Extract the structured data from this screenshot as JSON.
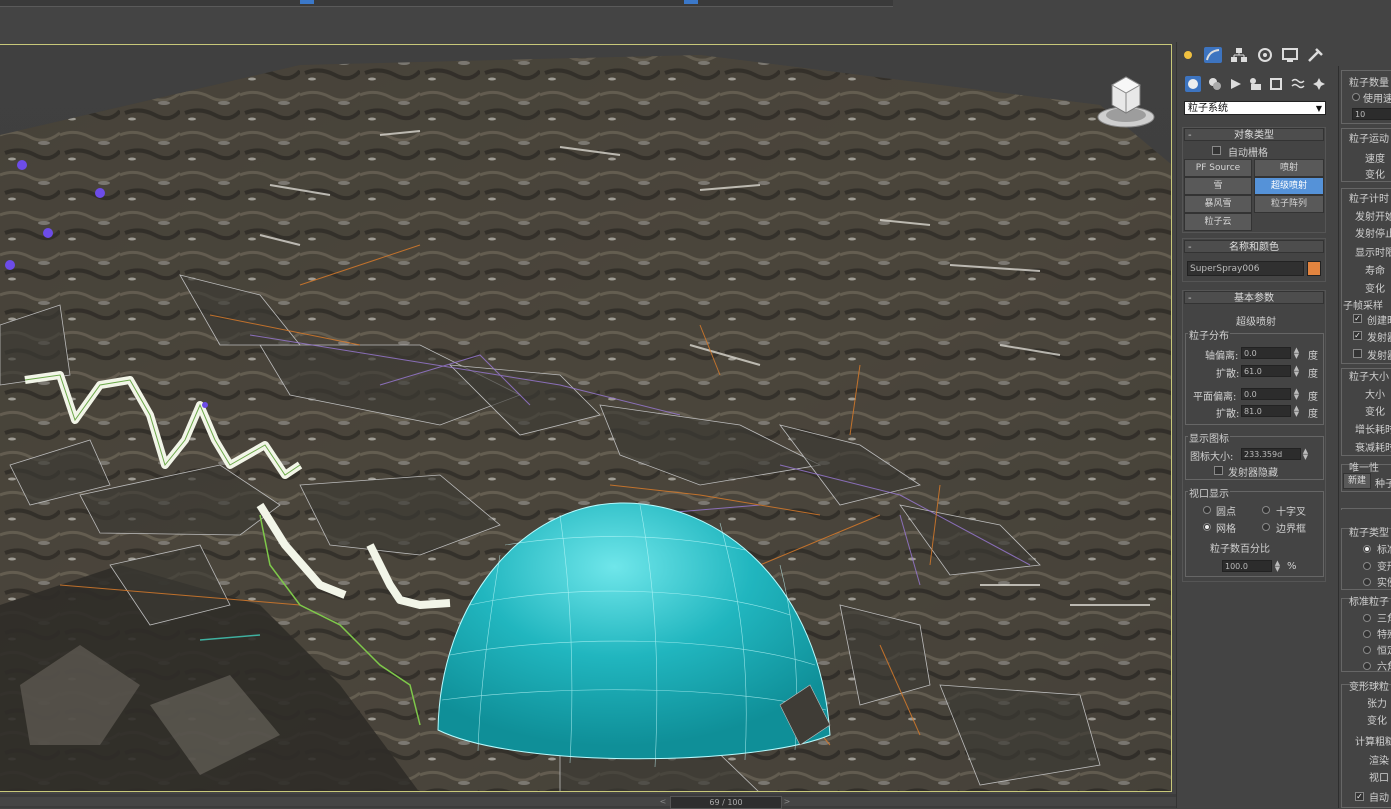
{
  "viewport": {
    "name": "perspective-viewport"
  },
  "timeline": {
    "frame_label": "69 / 100",
    "prev": "<",
    "next": ">"
  },
  "command_panel": {
    "tabs": [
      "create-tab",
      "modify-tab",
      "hierarchy-tab",
      "motion-tab",
      "display-tab",
      "utilities-tab"
    ],
    "subcategories": [
      "geometry",
      "shapes",
      "lights",
      "cameras",
      "helpers",
      "space-warps",
      "systems"
    ],
    "category_dropdown": "粒子系统",
    "object_type": {
      "title": "对象类型",
      "autogrid_label": "自动栅格",
      "buttons": [
        "PF Source",
        "喷射",
        "雪",
        "超级喷射",
        "暴风雪",
        "粒子阵列",
        "粒子云"
      ],
      "active": "超级喷射"
    },
    "name_color": {
      "title": "名称和颜色",
      "name_value": "SuperSpray006",
      "color": "#e2843f"
    },
    "basic_params": {
      "title": "基本参数",
      "subtitle": "超级喷射",
      "distribution_label": "粒子分布",
      "axis_offset_label": "轴偏离:",
      "axis_offset_value": "0.0",
      "spread1_label": "扩散:",
      "spread1_value": "61.0",
      "plane_offset_label": "平面偏离:",
      "plane_offset_value": "0.0",
      "spread2_label": "扩散:",
      "spread2_value": "81.0",
      "degree_unit": "度",
      "icon_group_label": "显示图标",
      "icon_size_label": "图标大小:",
      "icon_size_value": "233.359d",
      "emitter_hidden_label": "发射器隐藏",
      "viewport_display_label": "视口显示",
      "radio_dots": "圆点",
      "radio_ticks": "十字叉",
      "radio_mesh": "网格",
      "radio_bbox": "边界框",
      "percent_label": "粒子数百分比",
      "percent_value": "100.0",
      "percent_unit": "%"
    }
  },
  "side_panel": {
    "labels": [
      "粒子数量",
      "使用速",
      "10",
      "粒子运动",
      "速度",
      "变化",
      "粒子计时",
      "发射开始",
      "发射停止",
      "显示时限",
      "寿命",
      "变化",
      "子帧采样",
      "创建时",
      "发射器",
      "发射器",
      "粒子大小",
      "大小",
      "变化",
      "增长耗时",
      "衰减耗时",
      "唯一性",
      "新建",
      "种子",
      "粒子类型",
      "标准",
      "变形",
      "实例",
      "标准粒子",
      "三角",
      "特殊",
      "恒定",
      "六角",
      "变形球粒",
      "张力",
      "变化",
      "计算粗糙",
      "渲染",
      "视口",
      "自动"
    ]
  }
}
